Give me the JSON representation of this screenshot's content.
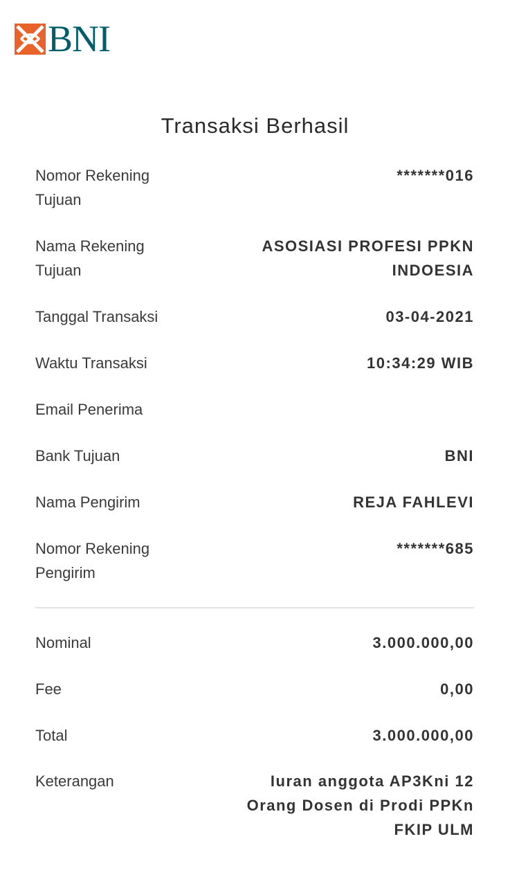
{
  "brand": {
    "logo_text": "BNI",
    "colors": {
      "orange": "#e8622a",
      "teal": "#005e6a"
    }
  },
  "title": "Transaksi Berhasil",
  "details": [
    {
      "label": "Nomor Rekening Tujuan",
      "value": "*******016"
    },
    {
      "label": "Nama Rekening Tujuan",
      "value": "ASOSIASI PROFESI PPKN INDOESIA"
    },
    {
      "label": "Tanggal Transaksi",
      "value": "03-04-2021"
    },
    {
      "label": "Waktu Transaksi",
      "value": "10:34:29 WIB"
    },
    {
      "label": "Email Penerima",
      "value": ""
    },
    {
      "label": "Bank Tujuan",
      "value": "BNI"
    },
    {
      "label": "Nama Pengirim",
      "value": "REJA FAHLEVI"
    },
    {
      "label": "Nomor Rekening Pengirim",
      "value": "*******685"
    }
  ],
  "summary": [
    {
      "label": "Nominal",
      "value": "3.000.000,00"
    },
    {
      "label": "Fee",
      "value": "0,00"
    },
    {
      "label": "Total",
      "value": "3.000.000,00"
    },
    {
      "label": "Keterangan",
      "value": "Iuran anggota AP3Kni 12 Orang Dosen di Prodi PPKn FKIP ULM"
    }
  ]
}
